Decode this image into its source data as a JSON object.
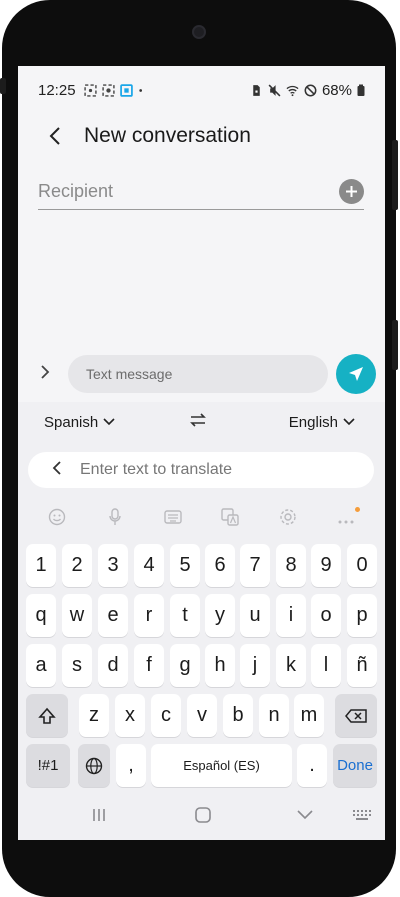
{
  "status_bar": {
    "time": "12:25",
    "battery": "68%",
    "icons": [
      "screenshot-icon",
      "screen-record-icon",
      "cast-icon",
      "dot-icon",
      "sim-lock-icon",
      "mute-icon",
      "wifi-icon",
      "dnd-icon",
      "battery-icon"
    ]
  },
  "header": {
    "title": "New conversation"
  },
  "recipient": {
    "placeholder": "Recipient"
  },
  "composer": {
    "placeholder": "Text message"
  },
  "translate": {
    "source_lang": "Spanish",
    "target_lang": "English",
    "input_placeholder": "Enter text to translate"
  },
  "toolbar": [
    "emoji-icon",
    "mic-icon",
    "clipboard-icon",
    "translate-icon",
    "settings-icon",
    "more-icon"
  ],
  "keyboard": {
    "row_numbers": [
      "1",
      "2",
      "3",
      "4",
      "5",
      "6",
      "7",
      "8",
      "9",
      "0"
    ],
    "row_q": [
      "q",
      "w",
      "e",
      "r",
      "t",
      "y",
      "u",
      "i",
      "o",
      "p"
    ],
    "row_a": [
      "a",
      "s",
      "d",
      "f",
      "g",
      "h",
      "j",
      "k",
      "l",
      "ñ"
    ],
    "row_z": [
      "z",
      "x",
      "c",
      "v",
      "b",
      "n",
      "m"
    ],
    "symbols": "!#1",
    "comma": ",",
    "space": "Español (ES)",
    "period": ".",
    "done": "Done"
  },
  "accent_color": "#16b1c4"
}
